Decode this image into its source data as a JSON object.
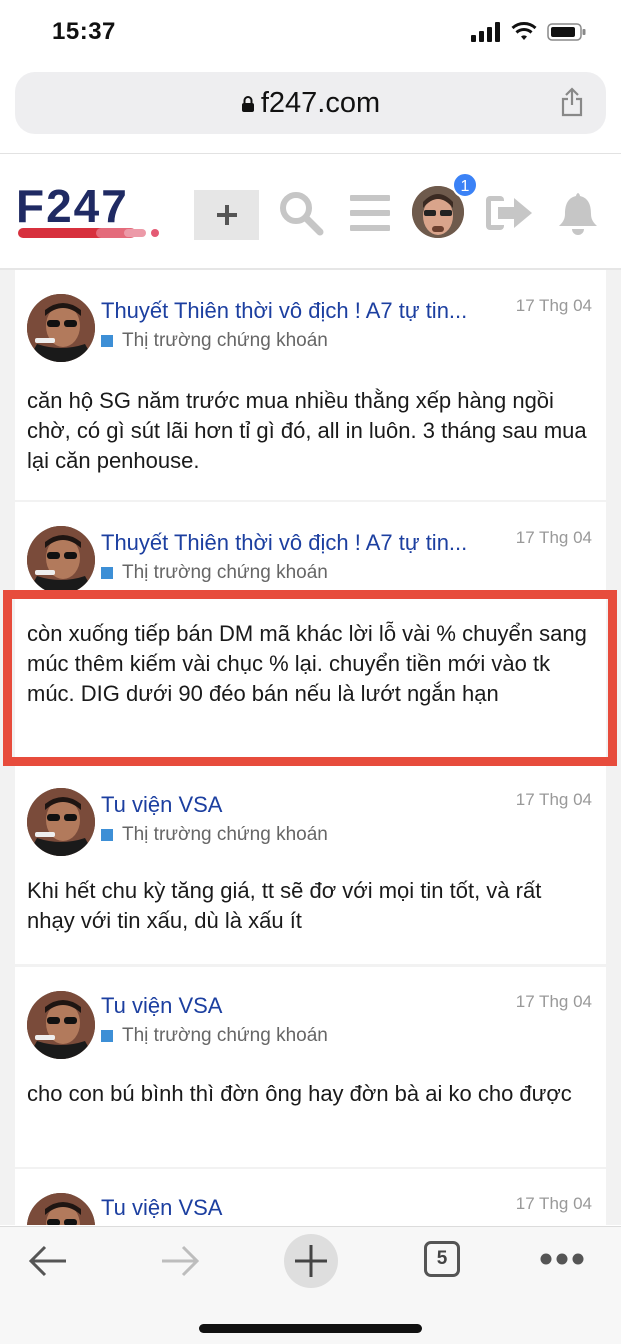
{
  "status_bar": {
    "time": "15:37"
  },
  "browser": {
    "url": "f247.com"
  },
  "header": {
    "logo_text": "F247",
    "notification_count": "1"
  },
  "posts": [
    {
      "title": "Thuyết Thiên thời vô địch ! A7 tự tin...",
      "date": "17 Thg 04",
      "category": "Thị trường chứng khoán",
      "body": "căn hộ SG năm trước mua nhiều thằng xếp hàng ngồi chờ, có gì sút lãi hơn tỉ gì đó, all in luôn. 3 tháng sau mua lại căn penhouse."
    },
    {
      "title": "Thuyết Thiên thời vô địch ! A7 tự tin...",
      "date": "17 Thg 04",
      "category": "Thị trường chứng khoán",
      "body": "còn xuống tiếp bán DM mã khác lời lỗ vài % chuyển sang múc thêm kiếm vài chục % lại. chuyển tiền mới vào tk múc. DIG dưới 90 đéo bán nếu là lướt ngắn hạn"
    },
    {
      "title": "Tu viện VSA",
      "date": "17 Thg 04",
      "category": "Thị trường chứng khoán",
      "body": "Khi hết chu kỳ tăng giá, tt sẽ đơ với mọi tin tốt, và rất nhạy với tin xấu, dù là xấu ít"
    },
    {
      "title": "Tu viện VSA",
      "date": "17 Thg 04",
      "category": "Thị trường chứng khoán",
      "body": "cho con bú bình thì đờn ông hay đờn bà ai ko cho được"
    },
    {
      "title": "Tu viện VSA",
      "date": "17 Thg 04",
      "category": "",
      "body": ""
    }
  ],
  "toolbar": {
    "tab_count": "5"
  },
  "colors": {
    "accent_red": "#e74c3c",
    "link_blue": "#1c3fa0",
    "category_blue": "#3d8fd6",
    "logo_navy": "#1f2a63"
  }
}
